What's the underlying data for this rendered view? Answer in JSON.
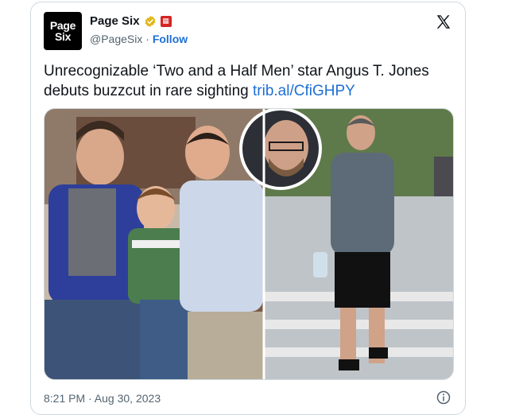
{
  "tweet": {
    "author_name": "Page Six",
    "author_handle": "@PageSix",
    "separator": "·",
    "follow_label": "Follow",
    "avatar_text_line1": "Page",
    "avatar_text_line2": "Six",
    "text": "Unrecognizable ‘Two and a Half Men’ star Angus T. Jones debuts buzzcut in rare sighting ",
    "link_text": "trib.al/CfiGHPY",
    "timestamp": "8:21 PM · Aug 30, 2023",
    "icons": {
      "verified": "verified-badge-gold-icon",
      "affiliate": "affiliate-badge-icon",
      "platform": "x-logo-icon",
      "info": "info-icon"
    },
    "colors": {
      "link": "#1d6fd6",
      "secondary_text": "#536471",
      "verified_gold": "#e2b719",
      "affiliate_red": "#d32525"
    }
  }
}
